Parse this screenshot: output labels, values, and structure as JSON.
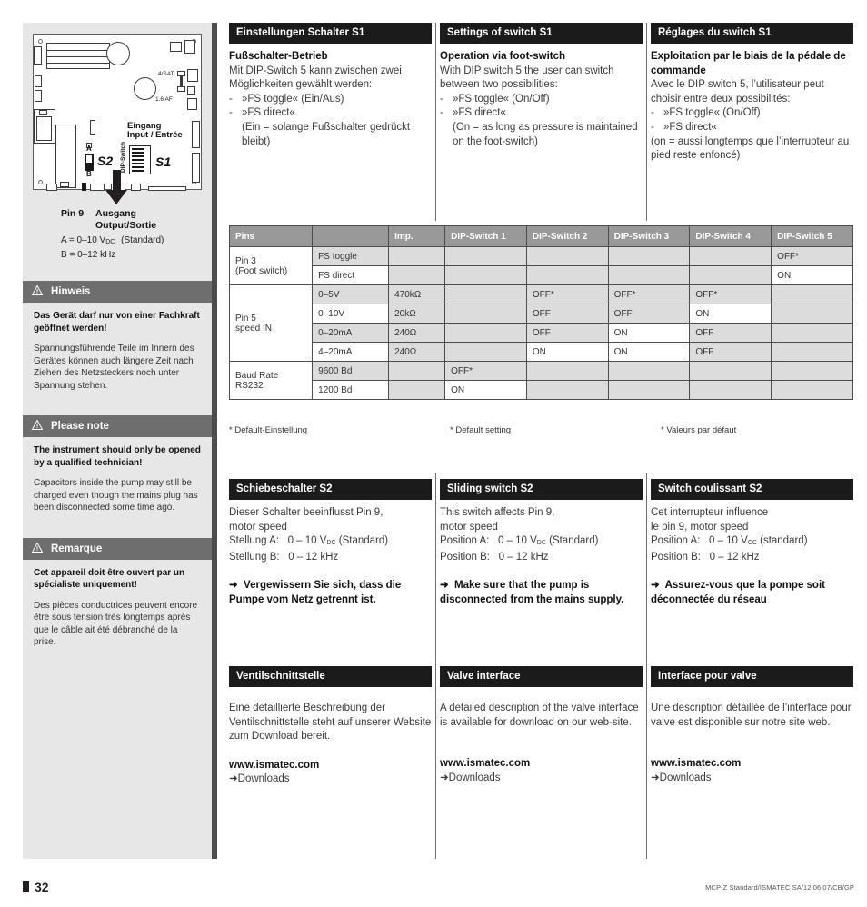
{
  "sidebar": {
    "figure": {
      "labels": {
        "fuse_top": "4/SAT",
        "fuse_bottom": "1.6 AF",
        "input_line1": "Eingang",
        "input_line2": "Input / Entrée",
        "dip_switch": "DIP-Switch",
        "s1": "S1",
        "s2": "S2",
        "pos_a": "A",
        "pos_b": "B"
      },
      "caption": {
        "pin": "Pin 9",
        "line1": "Ausgang",
        "line2": "Output/Sortie",
        "a_label": "A",
        "a_eq": "= 0–10 V",
        "a_sub": "DC",
        "a_note": "(Standard)",
        "b_label": "B",
        "b_eq": "= 0–12 kHz"
      }
    },
    "notices": [
      {
        "title": "Hinweis",
        "heading": "Das Gerät darf nur von einer Fachkraft geöffnet werden!",
        "text": "Spannungsführende Teile im Innern des Gerätes können auch längere Zeit nach Ziehen des Netzsteckers noch unter Spannung stehen."
      },
      {
        "title": "Please note",
        "heading": "The instrument should only be opened by a qualified technician!",
        "text": "Capacitors inside the pump may still be charged even though the mains plug has been disconnected some time ago."
      },
      {
        "title": "Remarque",
        "heading": "Cet appareil doit être ouvert par un spécialiste uniquement!",
        "text": "Des pièces conductrices peuvent encore être sous tension très longtemps après que le câble ait été débranché de la prise."
      }
    ]
  },
  "switch_s1": {
    "de": {
      "header": "Einstellungen Schalter S1",
      "subhead": "Fußschalter-Betrieb",
      "intro": "Mit DIP-Switch 5 kann zwischen zwei Möglichkeiten gewählt werden:",
      "bullets": [
        "»FS toggle« (Ein/Aus)",
        "»FS direct«"
      ],
      "note": "(Ein = solange Fußschalter gedrückt bleibt)"
    },
    "en": {
      "header": "Settings of switch S1",
      "subhead": "Operation via foot-switch",
      "intro": "With DIP switch 5 the user can switch between two possibilities:",
      "bullets": [
        "»FS toggle« (On/Off)",
        "»FS direct«"
      ],
      "note": "(On = as long as pressure is maintained on the foot-switch)"
    },
    "fr": {
      "header": "Réglages du switch S1",
      "subhead": "Exploitation par le biais de la pédale de commande",
      "intro": "Avec le DIP switch 5, l’utilisateur peut choisir entre deux possibilités:",
      "bullets": [
        "»FS toggle« (On/Off)",
        "»FS direct«"
      ],
      "note": "(on = aussi longtemps que l’interrupteur au pied reste enfoncé)"
    }
  },
  "table": {
    "headers": [
      "Pins",
      "",
      "Imp.",
      "DIP-Switch 1",
      "DIP-Switch 2",
      "DIP-Switch 3",
      "DIP-Switch 4",
      "DIP-Switch 5"
    ],
    "groups": [
      {
        "label": "Pin 3\n(Foot switch)",
        "rows": [
          {
            "mode": "FS toggle",
            "imp": "",
            "d1": "",
            "d2": "",
            "d3": "",
            "d4": "",
            "d5": "OFF*"
          },
          {
            "mode": "FS direct",
            "imp": "",
            "d1": "",
            "d2": "",
            "d3": "",
            "d4": "",
            "d5": "ON"
          }
        ]
      },
      {
        "label": "Pin 5\nspeed IN",
        "rows": [
          {
            "mode": "0–5V",
            "imp": "470kΩ",
            "d1": "",
            "d2": "OFF*",
            "d3": "OFF*",
            "d4": "OFF*",
            "d5": ""
          },
          {
            "mode": "0–10V",
            "imp": "20kΩ",
            "d1": "",
            "d2": "OFF",
            "d3": "OFF",
            "d4": "ON",
            "d5": ""
          },
          {
            "mode": "0–20mA",
            "imp": "240Ω",
            "d1": "",
            "d2": "OFF",
            "d3": "ON",
            "d4": "OFF",
            "d5": ""
          },
          {
            "mode": "4–20mA",
            "imp": "240Ω",
            "d1": "",
            "d2": "ON",
            "d3": "ON",
            "d4": "OFF",
            "d5": ""
          }
        ]
      },
      {
        "label": "Baud Rate\nRS232",
        "rows": [
          {
            "mode": "9600 Bd",
            "imp": "",
            "d1": "OFF*",
            "d2": "",
            "d3": "",
            "d4": "",
            "d5": ""
          },
          {
            "mode": "1200 Bd",
            "imp": "",
            "d1": "ON",
            "d2": "",
            "d3": "",
            "d4": "",
            "d5": ""
          }
        ]
      }
    ],
    "footnotes": {
      "de": "* Default-Einstellung",
      "en": "* Default setting",
      "fr": "* Valeurs par défaut"
    }
  },
  "switch_s2": {
    "de": {
      "header": "Schiebeschalter S2",
      "line1": "Dieser Schalter beeinflusst Pin 9,",
      "line2": "motor speed",
      "pos_a_label": "Stellung A:",
      "pos_a_value": "0 – 10 V",
      "pos_a_sub": "DC",
      "pos_a_note": "(Standard)",
      "pos_b_label": "Stellung B:",
      "pos_b_value": "0 – 12 kHz",
      "warning": "Vergewissern Sie sich, dass die Pumpe vom Netz getrennt ist."
    },
    "en": {
      "header": "Sliding switch S2",
      "line1": "This switch affects Pin 9,",
      "line2": "motor speed",
      "pos_a_label": "Position A:",
      "pos_a_value": "0 – 10 V",
      "pos_a_sub": "DC",
      "pos_a_note": "(Standard)",
      "pos_b_label": "Position B:",
      "pos_b_value": "0 – 12 kHz",
      "warning": "Make sure that the pump is disconnected from the mains supply."
    },
    "fr": {
      "header": "Switch coulissant S2",
      "line1": "Cet interrupteur influence",
      "line2": "le pin 9, motor speed",
      "pos_a_label": "Position A:",
      "pos_a_value": "0 – 10 V",
      "pos_a_sub": "CC",
      "pos_a_note": "(standard)",
      "pos_b_label": "Position B:",
      "pos_b_value": "0 – 12 kHz",
      "warning": "Assurez-vous que la pompe soit déconnectée du réseau"
    }
  },
  "valve": {
    "de": {
      "header": "Ventilschnittstelle",
      "text": "Eine detaillierte Beschreibung der Ventilschnittstelle steht auf unserer Website zum Download bereit.",
      "url": "www.ismatec.com",
      "link": "Downloads"
    },
    "en": {
      "header": "Valve interface",
      "text": "A detailed description of the valve interface is available for download on our web-site.",
      "url": "www.ismatec.com",
      "link": "Downloads"
    },
    "fr": {
      "header": "Interface pour valve",
      "text": "Une description détaillée de l’interface pour valve est disponible sur notre site web.",
      "url": "www.ismatec.com",
      "link": "Downloads"
    }
  },
  "footer": {
    "page_number": "32",
    "source": "MCP-Z Standard/ISMATEC SA/12.06.07/CB/GP"
  },
  "colors": {
    "sidebar_bg": "#e7e7e7",
    "notice_bar": "#6e6e6e",
    "header_bar": "#1b1b1b",
    "table_header": "#999999",
    "table_shade": "#dcdcdc",
    "rule": "#4d4d4d"
  }
}
